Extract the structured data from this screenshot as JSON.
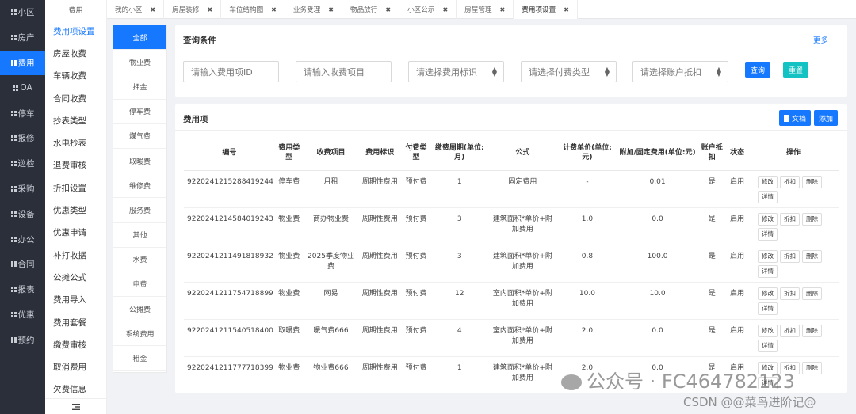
{
  "leftnav": [
    {
      "label": "小区",
      "active": false
    },
    {
      "label": "房产",
      "active": false
    },
    {
      "label": "费用",
      "active": true
    },
    {
      "label": "OA",
      "active": false
    },
    {
      "label": "停车",
      "active": false
    },
    {
      "label": "报修",
      "active": false
    },
    {
      "label": "巡检",
      "active": false
    },
    {
      "label": "采购",
      "active": false
    },
    {
      "label": "设备",
      "active": false
    },
    {
      "label": "办公",
      "active": false
    },
    {
      "label": "合同",
      "active": false
    },
    {
      "label": "报表",
      "active": false
    },
    {
      "label": "优惠",
      "active": false
    },
    {
      "label": "预约",
      "active": false
    }
  ],
  "subnav": {
    "header": "费用",
    "items": [
      "费用项设置",
      "房屋收费",
      "车辆收费",
      "合同收费",
      "抄表类型",
      "水电抄表",
      "退费审核",
      "折扣设置",
      "优惠类型",
      "优惠申请",
      "补打收据",
      "公摊公式",
      "费用导入",
      "费用套餐",
      "缴费审核",
      "取消费用",
      "欠费信息"
    ],
    "active_index": 0
  },
  "tabs": [
    {
      "label": "我的小区"
    },
    {
      "label": "房屋装修"
    },
    {
      "label": "车位结构图"
    },
    {
      "label": "业务受理"
    },
    {
      "label": "物品放行"
    },
    {
      "label": "小区公示"
    },
    {
      "label": "房屋管理"
    },
    {
      "label": "费用项设置"
    }
  ],
  "categories": [
    "全部",
    "物业费",
    "押金",
    "停车费",
    "煤气费",
    "取暖费",
    "维修费",
    "服务费",
    "其他",
    "水费",
    "电费",
    "公摊费",
    "系统费用",
    "租金"
  ],
  "query": {
    "title": "查询条件",
    "more": "更多",
    "fee_id_placeholder": "请输入费用项ID",
    "item_placeholder": "请输入收费项目",
    "flag_select": "请选择费用标识",
    "paytype_select": "请选择付费类型",
    "deduct_select": "请选择账户抵扣",
    "search_btn": "查询",
    "reset_btn": "重置"
  },
  "table_panel": {
    "title": "费用项",
    "doc_btn": "文档",
    "add_btn": "添加"
  },
  "table": {
    "headers": [
      "编号",
      "费用类型",
      "收费项目",
      "费用标识",
      "付费类型",
      "缴费周期(单位:月)",
      "公式",
      "计费单价(单位:元)",
      "附加/固定费用(单位:元)",
      "账户抵扣",
      "状态",
      "操作"
    ],
    "rows": [
      [
        "9220241215288419244",
        "停车费",
        "月租",
        "周期性费用",
        "预付费",
        "1",
        "固定费用",
        "-",
        "0.01",
        "是",
        "启用"
      ],
      [
        "9220241214584019243",
        "物业费",
        "商办物业费",
        "周期性费用",
        "预付费",
        "3",
        "建筑面积*单价+附加费用",
        "1.0",
        "0.0",
        "是",
        "启用"
      ],
      [
        "9220241211491818932",
        "物业费",
        "2025季度物业费",
        "周期性费用",
        "预付费",
        "3",
        "建筑面积*单价+附加费用",
        "0.8",
        "100.0",
        "是",
        "启用"
      ],
      [
        "9220241211754718899",
        "物业费",
        "网易",
        "周期性费用",
        "预付费",
        "12",
        "室内面积*单价+附加费用",
        "10.0",
        "10.0",
        "是",
        "启用"
      ],
      [
        "9220241211540518400",
        "取暖费",
        "暖气费666",
        "周期性费用",
        "预付费",
        "4",
        "室内面积*单价+附加费用",
        "2.0",
        "0.0",
        "是",
        "启用"
      ],
      [
        "9220241211777718399",
        "物业费",
        "物业费666",
        "周期性费用",
        "预付费",
        "1",
        "建筑面积*单价+附加费用",
        "2.0",
        "0.0",
        "是",
        "启用"
      ]
    ],
    "ops": [
      "修改",
      "折扣",
      "删除",
      "详情"
    ]
  },
  "watermark": {
    "main": "公众号 · FC464782123",
    "sub": "CSDN @@菜鸟进阶记@"
  },
  "colors": {
    "primary": "#1677ff",
    "reset": "#13c2c2",
    "nav_bg": "#2b2f3a"
  }
}
